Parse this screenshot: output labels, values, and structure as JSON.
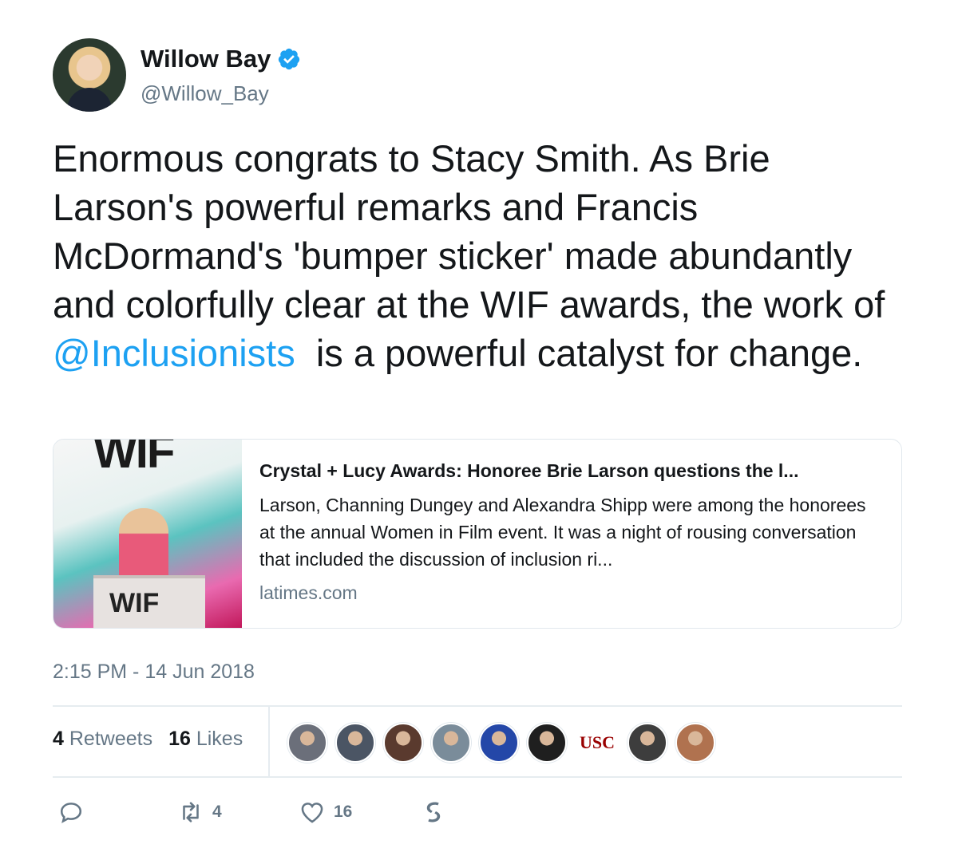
{
  "author": {
    "name": "Willow Bay",
    "handle": "@Willow_Bay",
    "verified": true
  },
  "tweet": {
    "text_before": "Enormous congrats to Stacy Smith. As Brie Larson's powerful remarks and Francis McDormand's 'bumper sticker' made abundantly and colorfully clear at the WIF awards, the work of ",
    "mention": "@Inclusionists",
    "text_after": "  is a powerful catalyst for change."
  },
  "card": {
    "title": "Crystal + Lucy Awards: Honoree Brie Larson questions the l...",
    "description": "Larson, Channing Dungey and Alexandra Shipp were among the honorees at the annual Women in Film event. It was a night of rousing conversation that included the discussion of inclusion ri...",
    "domain": "latimes.com",
    "image_text_top": "WIF",
    "image_text_bottom": "WIF"
  },
  "timestamp": "2:15 PM - 14 Jun 2018",
  "stats": {
    "retweets_count": "4",
    "retweets_label": "Retweets",
    "likes_count": "16",
    "likes_label": "Likes"
  },
  "likers": [
    {
      "name": "liker-1",
      "color": "#6b6f7a"
    },
    {
      "name": "liker-2",
      "color": "#4b5564"
    },
    {
      "name": "liker-3",
      "color": "#5a3a2e"
    },
    {
      "name": "liker-4",
      "color": "#7a8c9a"
    },
    {
      "name": "liker-5",
      "color": "#2447a8"
    },
    {
      "name": "liker-6",
      "color": "#1f1f1f"
    },
    {
      "name": "liker-usc",
      "label": "USC",
      "color": "#990000"
    },
    {
      "name": "liker-8",
      "color": "#3d3d3d"
    },
    {
      "name": "liker-9",
      "color": "#b0724f"
    }
  ],
  "actions": {
    "reply_count": "",
    "retweet_count": "4",
    "like_count": "16"
  },
  "colors": {
    "link": "#1da1f2",
    "muted": "#657786",
    "text": "#14171a"
  }
}
